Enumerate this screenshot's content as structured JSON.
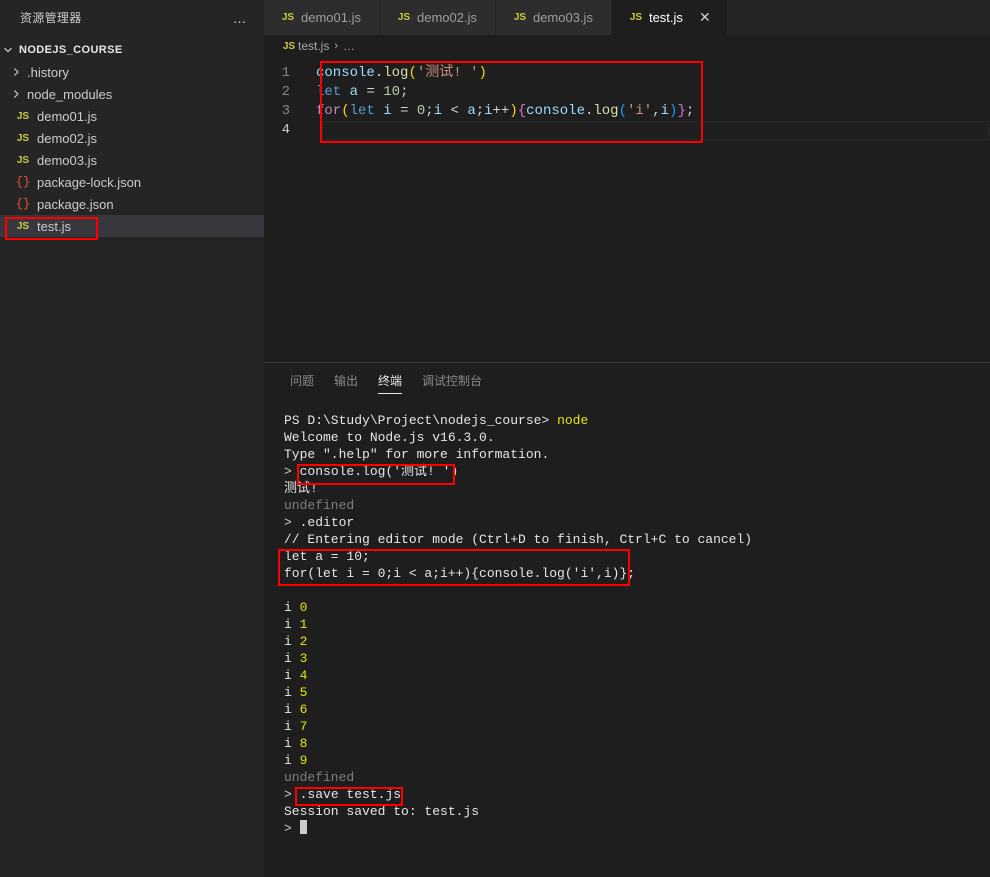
{
  "sidebar": {
    "title": "资源管理器",
    "more_icon": "…",
    "root": {
      "label": "NODEJS_COURSE",
      "icon": "chevron-down-icon"
    },
    "items": [
      {
        "label": ".history",
        "type": "folder",
        "icon": "chevron-right-icon",
        "selected": false
      },
      {
        "label": "node_modules",
        "type": "folder",
        "icon": "chevron-right-icon",
        "selected": false
      },
      {
        "label": "demo01.js",
        "type": "js",
        "icon": "js-icon",
        "selected": false
      },
      {
        "label": "demo02.js",
        "type": "js",
        "icon": "js-icon",
        "selected": false
      },
      {
        "label": "demo03.js",
        "type": "js",
        "icon": "js-icon",
        "selected": false
      },
      {
        "label": "package-lock.json",
        "type": "json",
        "icon": "json-icon",
        "selected": false
      },
      {
        "label": "package.json",
        "type": "json",
        "icon": "json-icon",
        "selected": false
      },
      {
        "label": "test.js",
        "type": "js",
        "icon": "js-icon",
        "selected": true
      }
    ],
    "js_badge": "JS",
    "json_badge": "{}"
  },
  "tabs": [
    {
      "label": "demo01.js",
      "active": false,
      "icon": "js-icon"
    },
    {
      "label": "demo02.js",
      "active": false,
      "icon": "js-icon"
    },
    {
      "label": "demo03.js",
      "active": false,
      "icon": "js-icon"
    },
    {
      "label": "test.js",
      "active": true,
      "icon": "js-icon"
    }
  ],
  "tab_close_icon": "✕",
  "breadcrumb": {
    "file": "test.js",
    "separator": "›",
    "tail": "…"
  },
  "editor": {
    "line_numbers": [
      "1",
      "2",
      "3",
      "4"
    ],
    "lines": [
      "console.log('测试! ')",
      "let a = 10;",
      "for(let i = 0;i < a;i++){console.log('i',i)};",
      ""
    ]
  },
  "panel": {
    "tabs": [
      {
        "label": "问题",
        "active": false
      },
      {
        "label": "输出",
        "active": false
      },
      {
        "label": "终端",
        "active": true
      },
      {
        "label": "调试控制台",
        "active": false
      }
    ]
  },
  "terminal": {
    "lines": [
      "PS D:\\Study\\Project\\nodejs_course> node",
      "Welcome to Node.js v16.3.0.",
      "Type \".help\" for more information.",
      "> console.log('测试! ')",
      "测试!",
      "undefined",
      "> .editor",
      "// Entering editor mode (Ctrl+D to finish, Ctrl+C to cancel)",
      "let a = 10;",
      "for(let i = 0;i < a;i++){console.log('i',i)};",
      "",
      "i 0",
      "i 1",
      "i 2",
      "i 3",
      "i 4",
      "i 5",
      "i 6",
      "i 7",
      "i 8",
      "i 9",
      "undefined",
      "> .save test.js",
      "Session saved to: test.js",
      ">"
    ],
    "prompt_char": ">",
    "command_node": "node",
    "ps_prefix": "PS D:\\Study\\Project\\nodejs_course>",
    "welcome": "Welcome to Node.js v16.3.0.",
    "help_hint": "Type \".help\" for more information.",
    "cmd_console_log": "console.log('测试! ')",
    "out_ceshi": "测试!",
    "undefined_1": "undefined",
    "cmd_editor": ".editor",
    "editor_mode_note": "// Entering editor mode (Ctrl+D to finish, Ctrl+C to cancel)",
    "block_line1": "let a = 10;",
    "block_line2": "for(let i = 0;i < a;i++){console.log('i',i)};",
    "loop_label": "i",
    "loop_values": [
      "0",
      "1",
      "2",
      "3",
      "4",
      "5",
      "6",
      "7",
      "8",
      "9"
    ],
    "undefined_2": "undefined",
    "cmd_save": ".save test.js",
    "session_saved": "Session saved to: test.js"
  },
  "annotations": {
    "color": "#ff0000",
    "boxes": [
      {
        "name": "sidebar-testjs-highlight"
      },
      {
        "name": "editor-code-highlight"
      },
      {
        "name": "terminal-consolelog-highlight"
      },
      {
        "name": "terminal-codeblock-highlight"
      },
      {
        "name": "terminal-save-highlight"
      }
    ]
  }
}
